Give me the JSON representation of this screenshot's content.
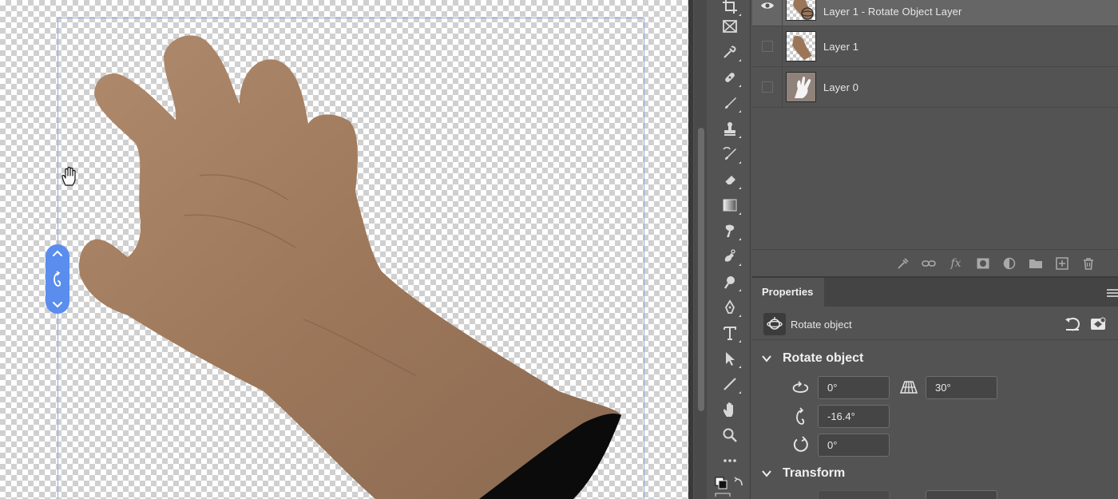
{
  "canvas": {
    "hand_cursor": "hand-cursor-icon",
    "rotation_widget": {
      "icons": [
        "chevron-up-icon",
        "rotate-y-icon",
        "chevron-down-icon"
      ],
      "accent": "#5b8def"
    }
  },
  "toolbar": {
    "tools": [
      "crop-icon",
      "frame-icon",
      "eyedropper-icon",
      "healing-brush-icon",
      "brush-icon",
      "stamp-icon",
      "history-brush-icon",
      "eraser-icon",
      "gradient-icon",
      "smudge-icon",
      "dodge-icon",
      "burn-icon",
      "pen-icon",
      "type-icon",
      "path-selection-icon",
      "line-icon",
      "hand-icon",
      "zoom-icon",
      "more-tools-icon",
      "swap-colors-icon"
    ]
  },
  "layers": {
    "rows": [
      {
        "name": "Layer 1 - Rotate Object Layer",
        "visible": true,
        "selected": true
      },
      {
        "name": "Layer 1",
        "visible": false,
        "selected": false
      },
      {
        "name": "Layer 0",
        "visible": false,
        "selected": false
      }
    ],
    "footer_icons": [
      "brush-clean-icon",
      "link-icon",
      "fx-icon",
      "mask-icon",
      "adjustment-icon",
      "folder-icon",
      "new-layer-icon",
      "trash-icon"
    ],
    "fx_label": "fx"
  },
  "properties": {
    "tab": "Properties",
    "object_label": "Rotate object",
    "sections": {
      "rotate_title": "Rotate object",
      "transform_title": "Transform"
    },
    "rotate": {
      "x_value": "0°",
      "fov_value": "30°",
      "y_value": "-16.4°",
      "z_value": "0°"
    }
  },
  "colors": {
    "panel_bg": "#535353",
    "selected_row": "#666666",
    "accent_blue": "#5b8def",
    "bbox_line": "#8fa6de"
  }
}
